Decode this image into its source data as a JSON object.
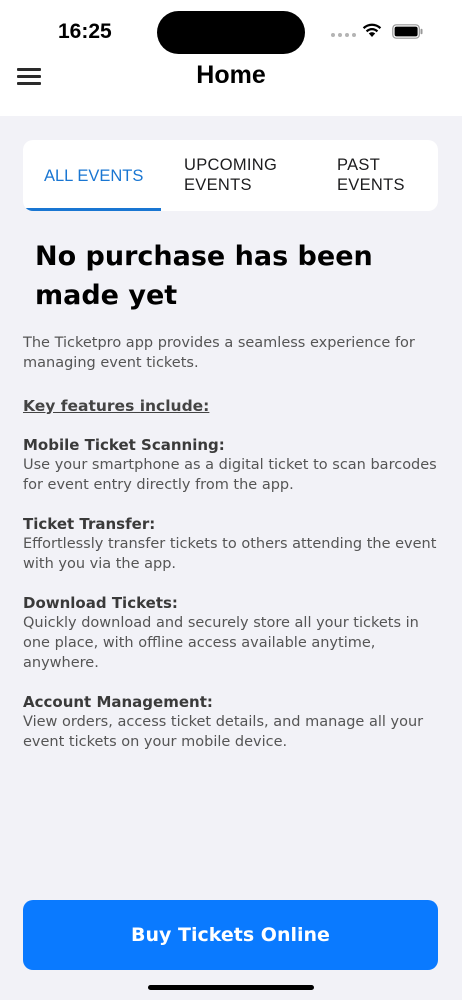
{
  "status_bar": {
    "time": "16:25"
  },
  "header": {
    "title": "Home"
  },
  "tabs": [
    {
      "label": "ALL EVENTS",
      "active": true
    },
    {
      "label": "UPCOMING EVENTS",
      "active": false
    },
    {
      "label": "PAST EVENTS",
      "active": false
    }
  ],
  "main": {
    "empty_heading": "No purchase has been made yet",
    "intro": "The Ticketpro app provides a seamless experience for managing event tickets.",
    "features_heading": "Key features include:",
    "features": [
      {
        "title": "Mobile Ticket Scanning:",
        "description": "Use your smartphone as a digital ticket to scan barcodes for event entry directly from the app."
      },
      {
        "title": "Ticket Transfer:",
        "description": "Effortlessly transfer tickets to others attending the event with you via the app."
      },
      {
        "title": "Download Tickets:",
        "description": "Quickly download and securely store all your tickets in one place, with offline access available anytime, anywhere."
      },
      {
        "title": "Account Management:",
        "description": "View orders, access ticket details, and manage all your event tickets on your mobile device."
      }
    ]
  },
  "footer": {
    "buy_button_label": "Buy Tickets Online"
  },
  "colors": {
    "accent": "#1976d2",
    "button": "#0a7aff",
    "background": "#f2f2f7"
  },
  "icons": [
    "menu-icon",
    "wifi-icon",
    "battery-icon",
    "cellular-signal-icon"
  ]
}
